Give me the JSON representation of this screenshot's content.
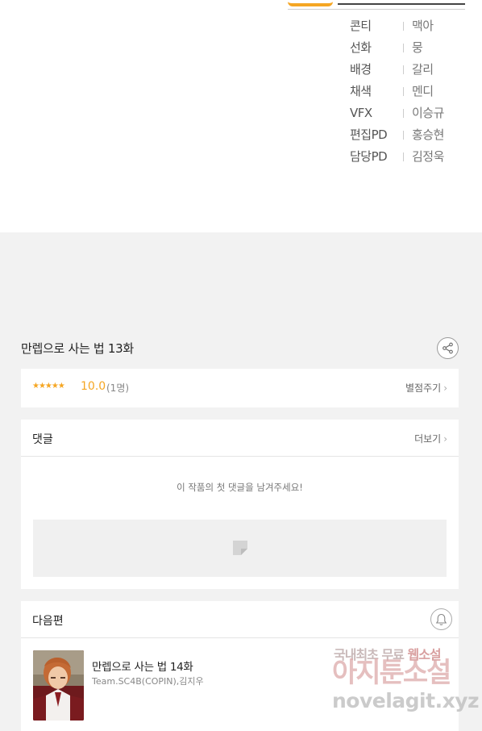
{
  "credits": [
    {
      "role": "콘티",
      "name": "맥아"
    },
    {
      "role": "선화",
      "name": "뭉"
    },
    {
      "role": "배경",
      "name": "갈리"
    },
    {
      "role": "채색",
      "name": "멘디"
    },
    {
      "role": "VFX",
      "name": "이승규"
    },
    {
      "role": "편집PD",
      "name": "홍승현"
    },
    {
      "role": "담당PD",
      "name": "김정욱"
    }
  ],
  "episode": {
    "title": "만렙으로 사는 법 13화"
  },
  "rating": {
    "stars": "★★★★★",
    "score": "10.0",
    "count": "(1명)",
    "rate_label": "별점주기"
  },
  "comments": {
    "title": "댓글",
    "more_label": "더보기",
    "empty_message": "이 작품의 첫 댓글을 남겨주세요!"
  },
  "next": {
    "section_title": "다음편",
    "title": "만렙으로 사는 법 14화",
    "author": "Team.SC4B(COPIN),김지우"
  },
  "watermark": {
    "line1_a": "국내최초 무료",
    "line1_b": "웹소설",
    "line2": "아지툰소설",
    "line3": "novelagit.xyz"
  },
  "colors": {
    "accent": "#f5a623",
    "background": "#f2f2f2",
    "card": "#ffffff"
  }
}
